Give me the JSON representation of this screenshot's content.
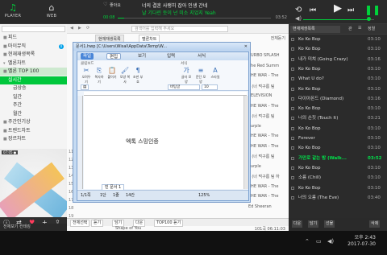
{
  "top": {
    "player_label": "PLAYER",
    "web_label": "WEB",
    "likes": "좋아요",
    "lyric_line1": "너의 결혼 사랭히 잡아 인생 간네",
    "lyric_line2": "날 기다린 듯이 넌 미소 지었지 Yeah",
    "time_current": "00:08",
    "time_total": "03:52",
    "progress": 0.04,
    "volume": 0.92
  },
  "left": {
    "items": [
      {
        "label": "피드",
        "type": "item"
      },
      {
        "label": "마이뮤직",
        "type": "item",
        "badge": "0"
      },
      {
        "label": "현재재생목록",
        "type": "item"
      },
      {
        "label": "멜론차트",
        "type": "header"
      },
      {
        "label": "멜론 TOP 100",
        "type": "sel"
      },
      {
        "label": "실시간",
        "type": "active"
      },
      {
        "label": "급상승",
        "type": "sub"
      },
      {
        "label": "일간",
        "type": "sub"
      },
      {
        "label": "주간",
        "type": "sub"
      },
      {
        "label": "월간",
        "type": "sub"
      },
      {
        "label": "주간인기상",
        "type": "item"
      },
      {
        "label": "트렌드차트",
        "type": "item"
      },
      {
        "label": "장르차트",
        "type": "item"
      }
    ],
    "album_tag": "07:05 ●",
    "bottom_strip": "전체보기    컨테킹"
  },
  "center": {
    "search_placeholder": "검색어를 입력해 주세요",
    "tabs": [
      "현재재생목록",
      "멜론차트"
    ],
    "tab_right": "전체듣기",
    "right_rows": [
      "TURBO SPLASH",
      "The Red Summ",
      "THE WAR - The",
      "'' (너 먹구름 팀",
      "TELEVISION",
      "THE WAR - The",
      "'' (너 먹구름 팀",
      "Purple",
      "THE WAR - The",
      "THE WAR - The",
      "'' (너 먹구름 팀",
      "Purple",
      "'' (너 먹구름 팀 하",
      "THE WAR - The",
      "THE WAR - The",
      "Ed Sheeran"
    ],
    "left_nums": [
      "11",
      "12",
      "13",
      "14",
      "15",
      "16",
      "17",
      "18",
      "19"
    ],
    "bar_buttons": [
      "전체선택",
      "듣기",
      "담기",
      "다운",
      "TOP100 듣기"
    ],
    "foot_left": "Shape of You",
    "foot_right": "101곡 06:11:03"
  },
  "editor": {
    "title": "문서1.hwp [C:\\Users\\Wisal\\AppData\\Temp\\W...",
    "menu": [
      "파일",
      "편집",
      "보기",
      "입력",
      "서식"
    ],
    "ribbon_groups": [
      "클립보드",
      "서식"
    ],
    "ribbon_buttons": [
      "오려두기",
      "복사하기",
      "붙이기",
      "모양 복사",
      "조판 부호",
      "글자 모양",
      "문단 모양",
      "스타일"
    ],
    "font_box": "바탕글",
    "size_box": "10",
    "body_text": "엑톡 스밍인증",
    "doc_tab": "빈 문서 1",
    "status": [
      "1/1쪽",
      "1단",
      "1줄",
      "14칸"
    ],
    "zoom": "125%"
  },
  "playlist": {
    "tab_label": "현재재생목록",
    "tab_icon": "관",
    "sort_label": "정렬",
    "rows": [
      {
        "title": "Ko Ko Bop",
        "dur": "03:10"
      },
      {
        "title": "Ko Ko Bop",
        "dur": "03:10"
      },
      {
        "title": "내가 미쳐 (Going Crazy)",
        "dur": "03:16"
      },
      {
        "title": "Ko Ko Bop",
        "dur": "03:10"
      },
      {
        "title": "What U do?",
        "dur": "03:10"
      },
      {
        "title": "Ko Ko Bop",
        "dur": "03:10"
      },
      {
        "title": "다이아몬드 (Diamond)",
        "dur": "03:16"
      },
      {
        "title": "Ko Ko Bop",
        "dur": "03:10"
      },
      {
        "title": "너의 손짓 (Touch It)",
        "dur": "03:21"
      },
      {
        "title": "Ko Ko Bop",
        "dur": "03:10"
      },
      {
        "title": "Forever",
        "dur": "03:10"
      },
      {
        "title": "Ko Ko Bop",
        "dur": "03:10"
      },
      {
        "title": "가만로 같는 밤 (Walk...",
        "dur": "03:52",
        "current": true
      },
      {
        "title": "Ko Ko Bop",
        "dur": "03:10"
      },
      {
        "title": "소름 (Chill)",
        "dur": "03:10"
      },
      {
        "title": "Ko Ko Bop",
        "dur": "03:10"
      },
      {
        "title": "너의 오름 (The Eve)",
        "dur": "03:40"
      }
    ],
    "foot_buttons": [
      "다운",
      "담기",
      "선물"
    ],
    "foot_right": "삭제"
  },
  "taskbar": {
    "time": "오후 2:43",
    "date": "2017-07-30"
  },
  "colors": {
    "accent": "#00c73c",
    "dark_bg": "#2b2b2b"
  }
}
